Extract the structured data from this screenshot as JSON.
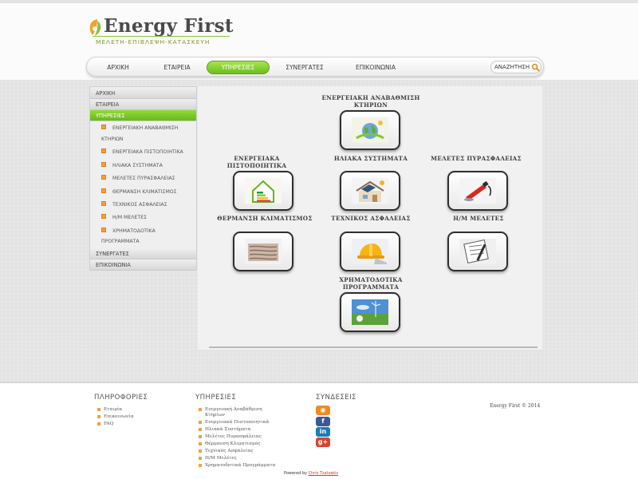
{
  "logo": {
    "title": "Energy First",
    "subtitle": "ΜΕΛΕΤΗ-ΕΠΙΒΛΕΨΗ-ΚΑΤΑΣΚΕΥΗ"
  },
  "nav": {
    "items": [
      "ΑΡΧΙΚΗ",
      "ΕΤΑΙΡΕΙΑ",
      "ΥΠΗΡΕΣΙΕΣ",
      "ΣΥΝΕΡΓΑΤΕΣ",
      "ΕΠΙΚΟΙΝΩΝΙΑ"
    ],
    "active": "ΥΠΗΡΕΣΙΕΣ",
    "search_placeholder": "ΑΝΑΖΗΤΗΣΗ"
  },
  "sidebar": {
    "top": [
      "ΑΡΧΙΚΗ",
      "ΕΤΑΙΡΕΙΑ",
      "ΥΠΗΡΕΣΙΕΣ"
    ],
    "sub": [
      "ΕΝΕΡΓΕΙΑΚΗ ΑΝΑΒΑΘΜΙΣΗ",
      "ΕΝΕΡΓΕΙΑΚΑ ΠΙΣΤΟΠΟΙΗΤΙΚΑ",
      "ΗΛΙΑΚΑ ΣΥΣΤΗΜΑΤΑ",
      "ΜΕΛΕΤΕΣ ΠΥΡΑΣΦΑΛΕΙΑΣ",
      "ΘΕΡΜΑΝΣΗ ΚΛΙΜΑΤΙΣΜΟΣ",
      "ΤΕΧΝΙΚΟΣ ΑΣΦΑΛΕΙΑΣ",
      "Η/Μ ΜΕΛΕΤΕΣ",
      "ΧΡΗΜΑΤΟΔΟΤΙΚΑ"
    ],
    "sub_wrap": [
      "ΚΤΗΡΙΩΝ",
      "ΠΡΟΓΡΑΜΜΑΤΑ"
    ],
    "bottom": [
      "ΣΥΝΕΡΓΑΤΕΣ",
      "ΕΠΙΚΟΙΝΩΝΙΑ"
    ]
  },
  "services": [
    {
      "label": "ΕΝΕΡΓΕΙΑΚΗ ΑΝΑΒΑΘΜΙΣΗ ΚΤΗΡΙΩΝ",
      "icon": "globe-icon"
    },
    {
      "label": "ΕΝΕΡΓΕΙΑΚΑ ΠΙΣΤΟΠΟΙΗΤΙΚΑ",
      "icon": "energy-house-icon"
    },
    {
      "label": "ΗΛΙΑΚΑ ΣΥΣΤΗΜΑΤΑ",
      "icon": "solar-house-icon"
    },
    {
      "label": "ΜΕΛΕΤΕΣ ΠΥΡΑΣΦΑΛΕΙΑΣ",
      "icon": "fire-extinguisher-icon"
    },
    {
      "label": "ΘΕΡΜΑΝΣΗ ΚΛΙΜΑΤΙΣΜΟΣ",
      "icon": "floor-heating-icon"
    },
    {
      "label": "ΤΕΧΝΙΚΟΣ ΑΣΦΑΛΕΙΑΣ",
      "icon": "hard-hat-icon"
    },
    {
      "label": "Η/Μ ΜΕΛΕΤΕΣ",
      "icon": "blueprint-icon"
    },
    {
      "label": "ΧΡΗΜΑΤΟΔΟΤΙΚΑ ΠΡΟΓΡΑΜΜΑΤΑ",
      "icon": "wind-turbines-icon"
    }
  ],
  "footer": {
    "info_title": "ΠΛΗΡΟΦΟΡΙΕΣ",
    "info_links": [
      "Εταιρία",
      "Επικοινωνία",
      "FAQ"
    ],
    "services_title": "ΥΠΗΡΕΣΙΕΣ",
    "services_links": [
      "Ενεργειακή Αναβάθμιση",
      "Κτηρίων",
      "Ενεργειακά Πιστοποιητικά",
      "Ηλιακά Συστήματα",
      "Μελέτες Πυρασφάλειας",
      "Θέρμανση Κλιματισμός",
      "Τεχνικός Ασφαλείας",
      "Η/Μ Μελέτες",
      "Χρηματοδοτικά Προγράμματα"
    ],
    "links_title": "ΣΥΝΔΕΣΕΙΣ",
    "social_icons": [
      "rss-icon",
      "facebook-icon",
      "linkedin-icon",
      "google-plus-icon"
    ],
    "social_glyphs": [
      "◉",
      "f",
      "in",
      "g+"
    ],
    "copyright": "Energy First © 2014",
    "powered_by": "Powered by",
    "author": "Chris Tzatzakis"
  },
  "colors": {
    "accent_green": "#7cc832",
    "bullet_orange": "#f2a03d",
    "rss": "#f28a1d",
    "facebook": "#3b5998",
    "linkedin": "#1b7bb5",
    "google_plus": "#d6432f"
  }
}
